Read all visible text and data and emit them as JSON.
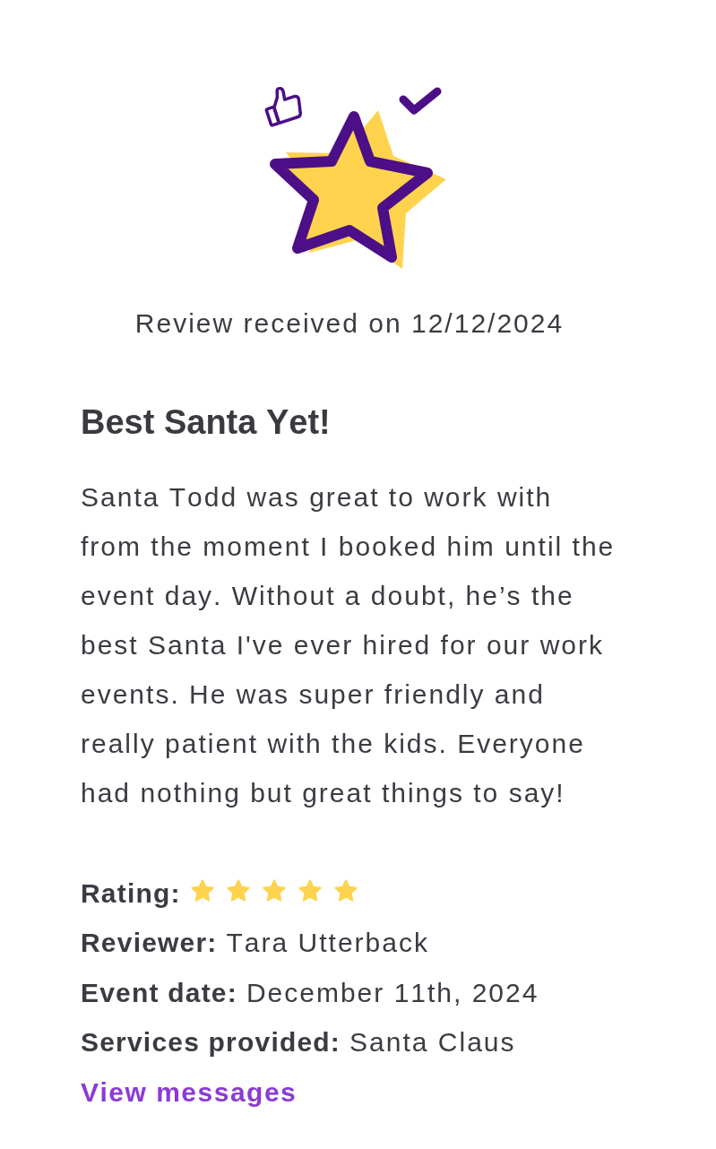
{
  "received_text": "Review received on 12/12/2024",
  "review": {
    "title": "Best Santa Yet!",
    "body": "Santa Todd was great to work with from the moment I booked him until the event day. Without a doubt, he’s the best Santa I've ever hired for our work events. He was super friendly and really patient with the kids. Everyone had nothing but great things to say!"
  },
  "details": [
    {
      "kind": "rating",
      "label": "Rating:",
      "stars": 5
    },
    {
      "kind": "field",
      "label": "Reviewer:",
      "value": "Tara Utterback"
    },
    {
      "kind": "field",
      "label": "Event date:",
      "value": "December 11th, 2024"
    },
    {
      "kind": "field",
      "label": "Services provided:",
      "value": "Santa Claus"
    }
  ],
  "link": {
    "label": "View messages"
  }
}
